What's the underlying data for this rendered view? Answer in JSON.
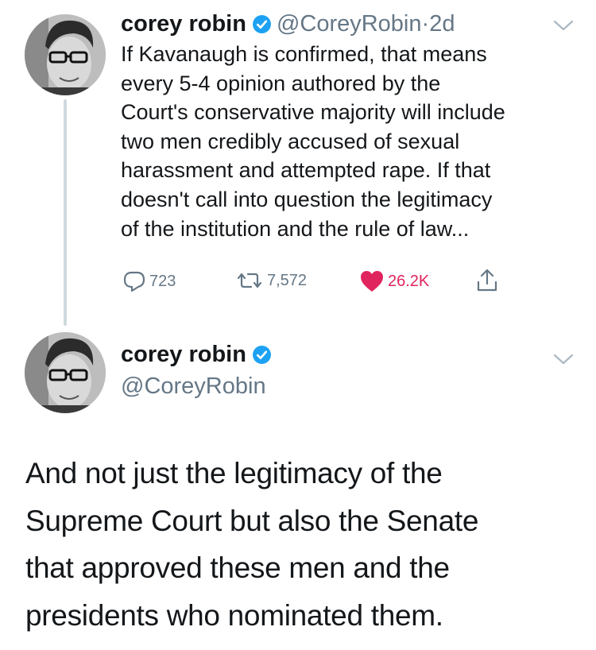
{
  "tweet1": {
    "display_name": "corey robin",
    "handle": "@CoreyRobin",
    "separator": "·",
    "time": "2d",
    "lines": [
      "If Kavanaugh is confirmed, that means",
      "every 5-4 opinion authored by the",
      "Court's conservative majority will include",
      "two men credibly accused of sexual",
      "harassment and attempted rape. If that",
      "doesn't call into question the legitimacy",
      "of the institution and the rule of law..."
    ],
    "replies": "723",
    "retweets": "7,572",
    "likes": "26.2K"
  },
  "tweet2": {
    "display_name": "corey robin",
    "handle": "@CoreyRobin",
    "lines": [
      "And not just the legitimacy of the",
      "Supreme Court but also the Senate",
      "that approved these men and the",
      "presidents who nominated them."
    ]
  },
  "colors": {
    "verified": "#1da1f2",
    "like": "#e0245e",
    "muted": "#657786",
    "thread": "#cfd9de"
  },
  "icons": [
    "verified-badge-icon",
    "chevron-down-icon",
    "reply-icon",
    "retweet-icon",
    "heart-icon",
    "share-icon"
  ]
}
